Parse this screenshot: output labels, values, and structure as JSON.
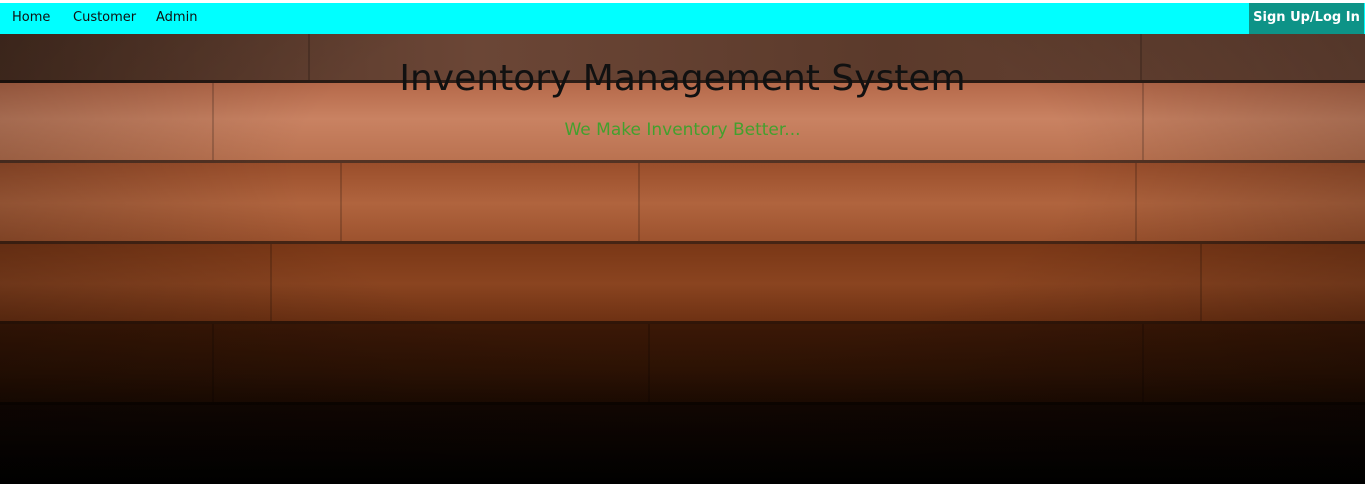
{
  "nav": {
    "items": [
      {
        "label": "Home"
      },
      {
        "label": "Customer"
      },
      {
        "label": "Admin"
      }
    ],
    "signup_label": "Sign Up/Log In"
  },
  "hero": {
    "title": "Inventory Management System",
    "subtitle": "We Make Inventory Better..."
  },
  "colors": {
    "navbar": "#00ffff",
    "signup_button": "#0d9387",
    "subtitle": "#43a02e"
  }
}
